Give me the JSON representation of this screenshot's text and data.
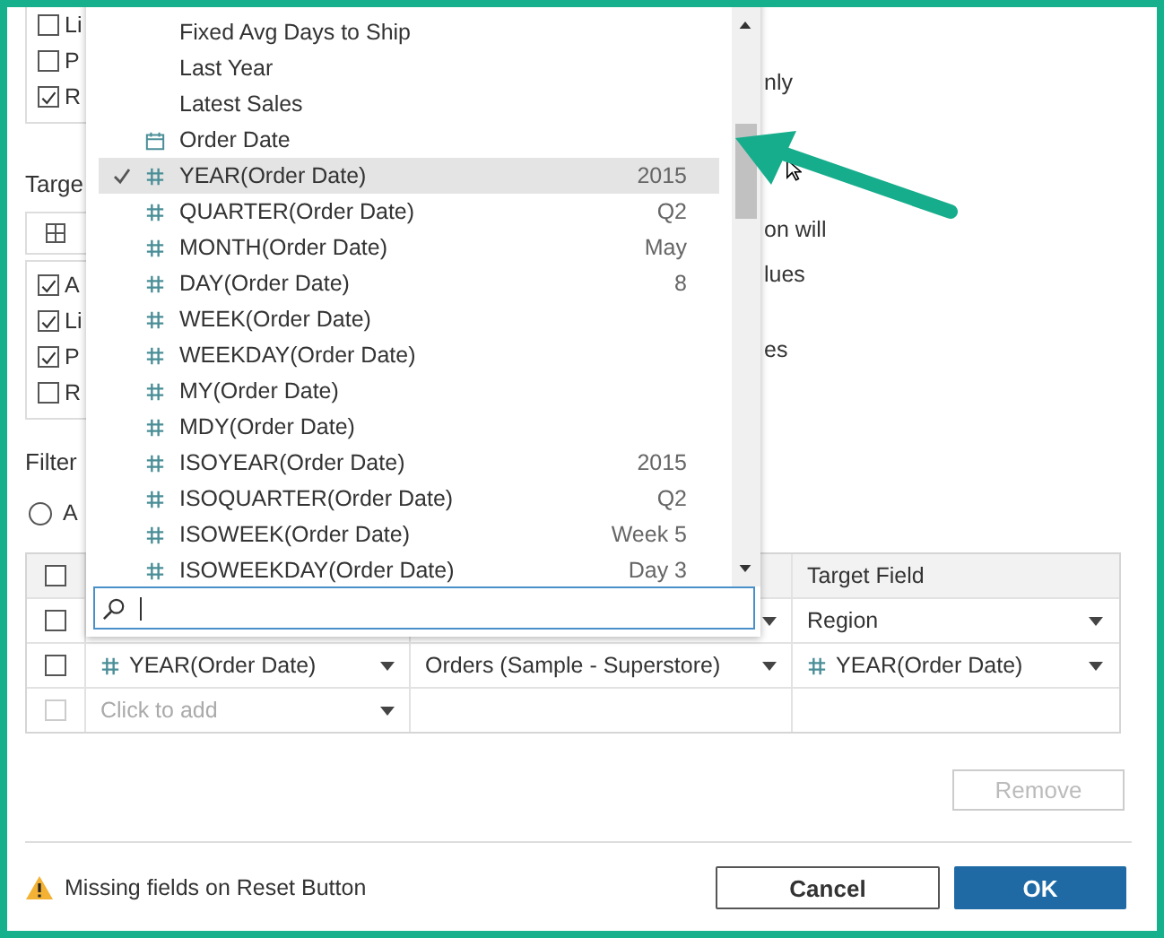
{
  "top_group": {
    "options": [
      {
        "label": "Li",
        "checked": false
      },
      {
        "label": "P",
        "checked": false
      },
      {
        "label": "R",
        "checked": true
      }
    ]
  },
  "side_text": [
    "nly",
    "on will",
    "lues",
    "es"
  ],
  "target": {
    "label": "Targe",
    "options": [
      {
        "label": "A",
        "checked": true
      },
      {
        "label": "Li",
        "checked": true
      },
      {
        "label": "P",
        "checked": true
      },
      {
        "label": "R",
        "checked": false
      }
    ]
  },
  "filter": {
    "label": "Filter",
    "radio": {
      "label": "A",
      "selected": false
    }
  },
  "table": {
    "column_4": "Target Field",
    "header_checked": false,
    "rows": [
      {
        "checked": false,
        "disabled": false,
        "source": null,
        "target": {
          "kind": "plain",
          "text": "Region"
        }
      },
      {
        "checked": false,
        "disabled": false,
        "source": {
          "kind": "number",
          "text": "YEAR(Order Date)"
        },
        "sheet": "Orders (Sample - Superstore)",
        "target": {
          "kind": "number",
          "text": "YEAR(Order Date)"
        }
      },
      {
        "checked": false,
        "disabled": true,
        "placeholder": "Click to add"
      }
    ]
  },
  "remove_button": {
    "label": "Remove",
    "disabled": true
  },
  "warning": "Missing fields on Reset Button",
  "buttons": [
    {
      "label": "Cancel",
      "kind": "secondary"
    },
    {
      "label": "OK",
      "kind": "primary"
    }
  ],
  "dropdown": {
    "items": [
      {
        "label": "Fixed Avg Days to Ship",
        "kind": "plain",
        "selected": false
      },
      {
        "label": "Last Year",
        "kind": "plain",
        "selected": false
      },
      {
        "label": "Latest Sales",
        "kind": "plain",
        "selected": false
      },
      {
        "label": "Order Date",
        "kind": "date",
        "selected": false
      },
      {
        "label": "YEAR(Order Date)",
        "kind": "number",
        "value": "2015",
        "selected": true
      },
      {
        "label": "QUARTER(Order Date)",
        "kind": "number",
        "value": "Q2",
        "selected": false
      },
      {
        "label": "MONTH(Order Date)",
        "kind": "number",
        "value": "May",
        "selected": false
      },
      {
        "label": "DAY(Order Date)",
        "kind": "number",
        "value": "8",
        "selected": false
      },
      {
        "label": "WEEK(Order Date)",
        "kind": "number",
        "selected": false
      },
      {
        "label": "WEEKDAY(Order Date)",
        "kind": "number",
        "selected": false
      },
      {
        "label": "MY(Order Date)",
        "kind": "number",
        "selected": false
      },
      {
        "label": "MDY(Order Date)",
        "kind": "number",
        "selected": false
      },
      {
        "label": "ISOYEAR(Order Date)",
        "kind": "number",
        "value": "2015",
        "selected": false
      },
      {
        "label": "ISOQUARTER(Order Date)",
        "kind": "number",
        "value": "Q2",
        "selected": false
      },
      {
        "label": "ISOWEEK(Order Date)",
        "kind": "number",
        "value": "Week 5",
        "selected": false
      },
      {
        "label": "ISOWEEKDAY(Order Date)",
        "kind": "number",
        "value": "Day 3",
        "selected": false
      }
    ]
  }
}
